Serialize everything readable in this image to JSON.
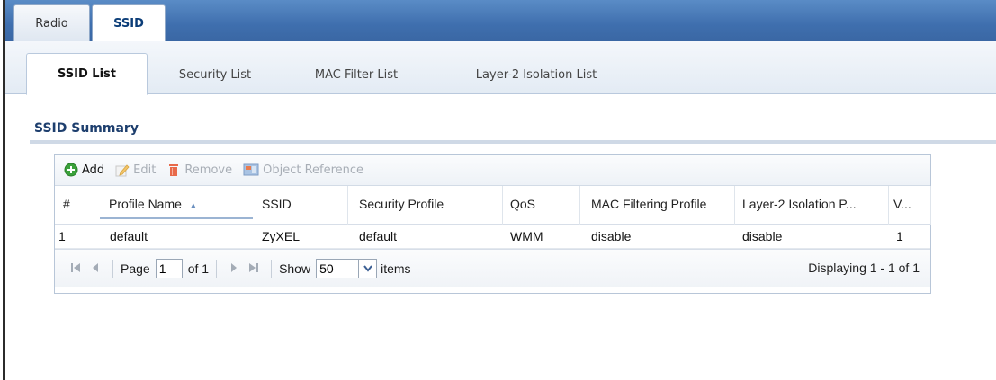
{
  "top_tabs": [
    {
      "label": "Radio",
      "active": false
    },
    {
      "label": "SSID",
      "active": true
    }
  ],
  "sub_tabs": [
    {
      "label": "SSID List",
      "active": true
    },
    {
      "label": "Security List",
      "active": false
    },
    {
      "label": "MAC Filter List",
      "active": false
    },
    {
      "label": "Layer-2 Isolation List",
      "active": false
    }
  ],
  "section": {
    "title": "SSID Summary"
  },
  "toolbar": {
    "add": "Add",
    "edit": "Edit",
    "remove": "Remove",
    "object_reference": "Object Reference"
  },
  "table": {
    "columns": [
      "#",
      "Profile Name",
      "SSID",
      "Security Profile",
      "QoS",
      "MAC Filtering Profile",
      "Layer-2 Isolation P...",
      "V..."
    ],
    "sort_indicator": "▲",
    "rows": [
      [
        "1",
        "default",
        "ZyXEL",
        "default",
        "WMM",
        "disable",
        "disable",
        "1"
      ]
    ]
  },
  "pager": {
    "page_label": "Page",
    "page_value": "1",
    "of_label": "of 1",
    "show_label": "Show",
    "show_value": "50",
    "items_label": "items",
    "displaying": "Displaying 1 - 1 of 1"
  },
  "colors": {
    "topbar": "#3f6fae",
    "accent": "#1e3f6e",
    "add_icon": "#3aa13a",
    "remove_icon": "#d9542b"
  }
}
